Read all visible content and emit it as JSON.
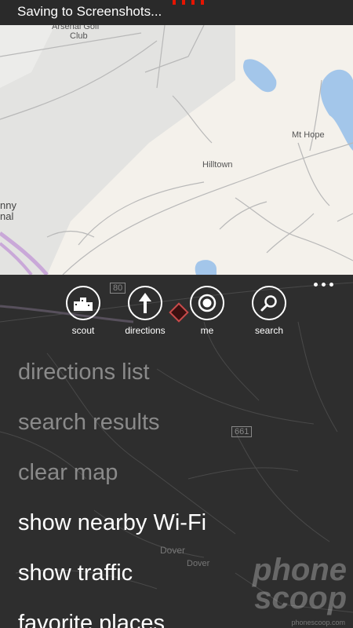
{
  "status_bar": {
    "text": "Saving to Screenshots..."
  },
  "map": {
    "labels": {
      "arsenal_golf": "Arsenal Golf",
      "club": "Club",
      "mt_hope": "Mt Hope",
      "hilltown": "Hilltown",
      "nny": "nny",
      "nal": "nal"
    },
    "route_shield": "80",
    "road_shield": "661",
    "dover_labels": [
      "Dover",
      "Dover"
    ]
  },
  "app_bar": {
    "buttons": [
      {
        "label": "scout",
        "icon": "scout-icon"
      },
      {
        "label": "directions",
        "icon": "directions-icon"
      },
      {
        "label": "me",
        "icon": "me-icon"
      },
      {
        "label": "search",
        "icon": "search-icon"
      }
    ],
    "more_icon": "ellipsis-icon"
  },
  "menu": {
    "items": [
      {
        "label": "directions list",
        "enabled": false
      },
      {
        "label": "search results",
        "enabled": false
      },
      {
        "label": "clear map",
        "enabled": false
      },
      {
        "label": "show nearby Wi-Fi",
        "enabled": true
      },
      {
        "label": "show traffic",
        "enabled": true
      },
      {
        "label": "favorite places",
        "enabled": true
      }
    ]
  },
  "watermark": {
    "line1": "phone",
    "line2": "scoop",
    "url": "phonescoop.com"
  },
  "colors": {
    "menu_disabled": "#8a8a8a",
    "menu_enabled": "#ffffff",
    "panel_bg": "#2e2e2e",
    "map_bg": "#f2efe9",
    "water": "#a3c6ea",
    "progress": "#e51400"
  }
}
